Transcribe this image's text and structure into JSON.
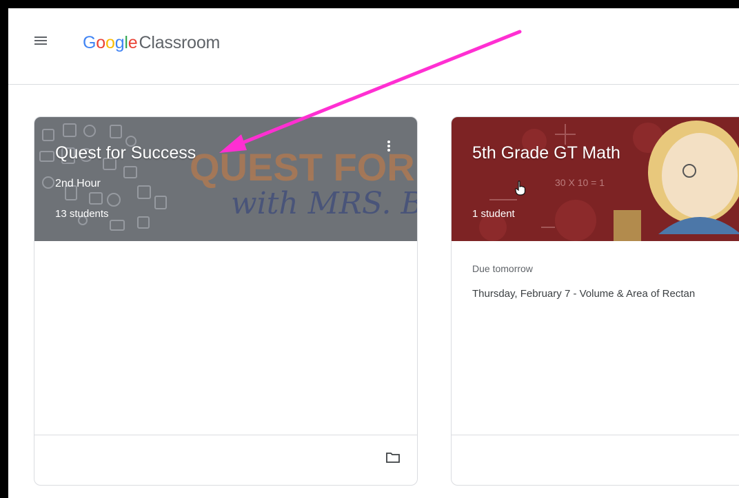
{
  "header": {
    "logo_letters": [
      {
        "char": "G",
        "color": "#4285F4"
      },
      {
        "char": "o",
        "color": "#EA4335"
      },
      {
        "char": "o",
        "color": "#FBBC05"
      },
      {
        "char": "g",
        "color": "#4285F4"
      },
      {
        "char": "l",
        "color": "#34A853"
      },
      {
        "char": "e",
        "color": "#EA4335"
      }
    ],
    "app_name": "Classroom"
  },
  "cards": [
    {
      "title": "Quest for Success",
      "section": "2nd Hour",
      "count": "13 students",
      "banner_text_1": "QUEST FOR SU",
      "banner_text_2": "with MRS. BRA"
    },
    {
      "title": "5th Grade GT Math",
      "section": "",
      "count": "1 student",
      "due_label": "Due tomorrow",
      "assignment": "Thursday, February 7 - Volume & Area of Rectan",
      "banner_text_1": "30 X 10 = 1"
    }
  ],
  "colors": {
    "annotation_arrow": "#ff2fd2",
    "card1_banner": "#6e7277",
    "card2_banner": "#7d2324"
  }
}
